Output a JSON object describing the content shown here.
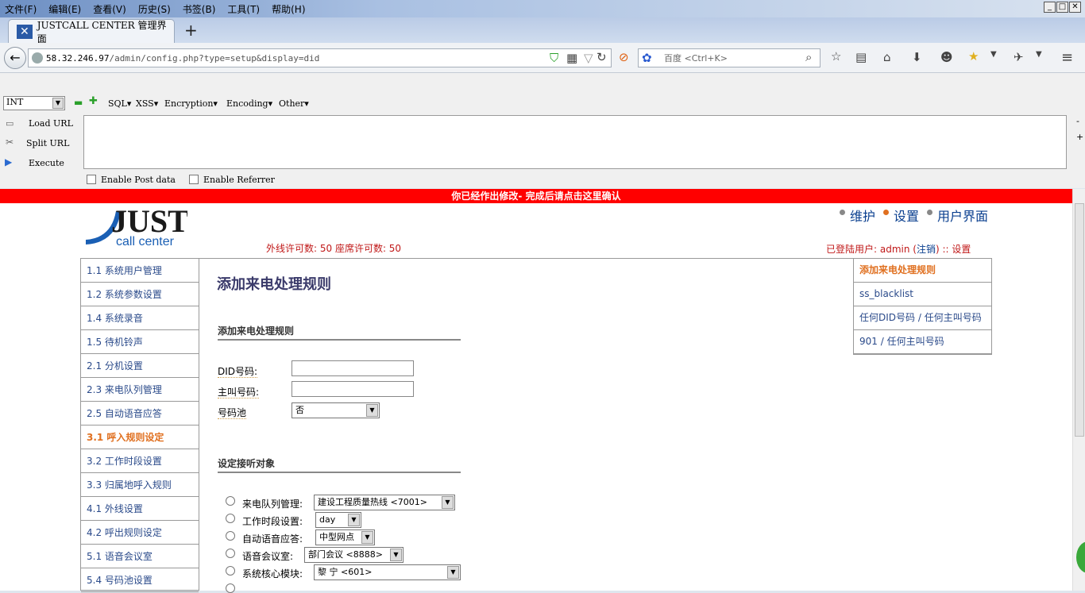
{
  "menu": [
    "文件(F)",
    "编辑(E)",
    "查看(V)",
    "历史(S)",
    "书签(B)",
    "工具(T)",
    "帮助(H)"
  ],
  "tab": {
    "title": "JUSTCALL CENTER 管理界面"
  },
  "url": {
    "host": "58.32.246.97",
    "path": "/admin/config.php?type=setup&display=did"
  },
  "search": {
    "placeholder": "百度 <Ctrl+K>"
  },
  "hackbar": {
    "select": "INT",
    "menus": [
      "SQL▾",
      "XSS▾",
      "Encryption▾",
      "Encoding▾",
      "Other▾"
    ],
    "load": "Load URL",
    "split": "Split URL",
    "execute": "Execute",
    "post": "Enable Post data",
    "referrer": "Enable Referrer"
  },
  "banner": "你已经作出修改- 完成后请点击这里确认",
  "toplinks": [
    "维护",
    "设置",
    "用户界面"
  ],
  "license": "外线许可数: 50 座席许可数: 50",
  "userinfo": {
    "prefix": "已登陆用户: admin (",
    "logout": "注销",
    "suffix": ") :: 设置"
  },
  "logo": {
    "big": "JUST",
    "small": "call center"
  },
  "leftnav": [
    "1.1 系统用户管理",
    "1.2 系统参数设置",
    "1.4 系统录音",
    "1.5 待机铃声",
    "2.1 分机设置",
    "2.3 来电队列管理",
    "2.5 自动语音应答",
    "3.1 呼入规则设定",
    "3.2 工作时段设置",
    "3.3 归属地呼入规则",
    "4.1 外线设置",
    "4.2 呼出规则设定",
    "5.1 语音会议室",
    "5.4 号码池设置"
  ],
  "rightnav": [
    "添加来电处理规则",
    "ss_blacklist",
    "任何DID号码 / 任何主叫号码",
    "901 / 任何主叫号码"
  ],
  "main": {
    "title": "添加来电处理规则",
    "section1": "添加来电处理规则",
    "did_label": "DID号码:",
    "cid_label": "主叫号码:",
    "pool_label": "号码池",
    "pool_value": "否",
    "section2": "设定接听对象",
    "targets": [
      {
        "label": "来电队列管理:",
        "value": "建设工程质量热线 <7001>"
      },
      {
        "label": "工作时段设置:",
        "value": "day"
      },
      {
        "label": "自动语音应答:",
        "value": "中型网点"
      },
      {
        "label": "语音会议室:",
        "value": "部门会议 <8888>"
      },
      {
        "label": "系统核心模块:",
        "value": "黎 宁 <601>"
      }
    ]
  },
  "colors": {
    "banner": "#ff0000",
    "accent": "#e07020",
    "link": "#2a4a8a",
    "alert": "#c01818"
  }
}
